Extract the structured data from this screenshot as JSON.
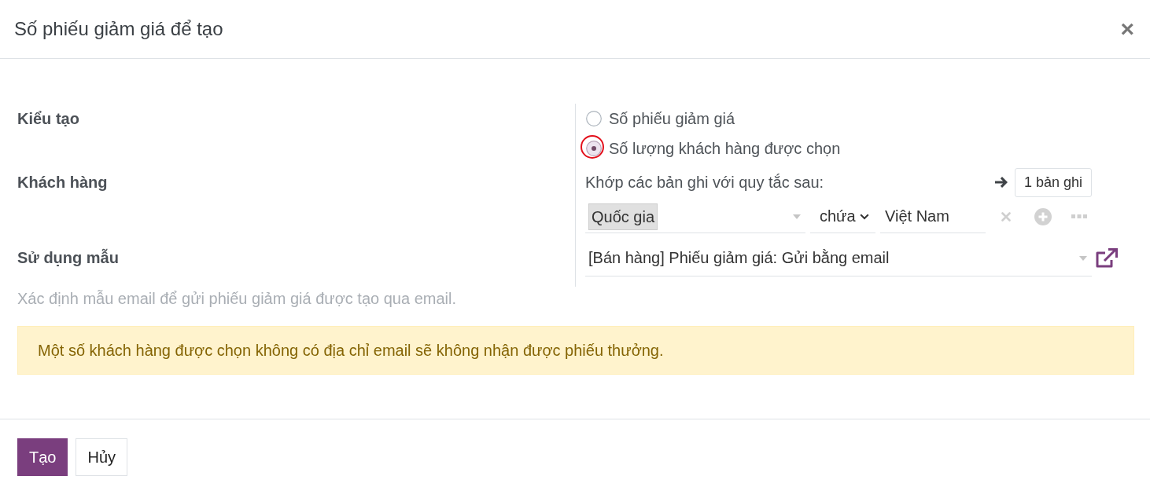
{
  "dialog": {
    "title": "Số phiếu giảm giá để tạo",
    "close": "×"
  },
  "fields": [
    {
      "kind": "radio",
      "label": "Kiểu tạo",
      "options": [
        {
          "label": "Số phiếu giảm giá",
          "selected": false,
          "highlighted": false
        },
        {
          "label": "Số lượng khách hàng được chọn",
          "selected": true,
          "highlighted": true
        }
      ]
    },
    {
      "kind": "domain",
      "label": "Khách hàng",
      "intro": "Khớp các bản ghi với quy tắc sau:",
      "record_count": "1 bản ghi",
      "rules": [
        {
          "field": "Quốc gia",
          "operator": "chứa",
          "value": "Việt Nam"
        }
      ]
    },
    {
      "kind": "select",
      "label": "Sử dụng mẫu",
      "value": "[Bán hàng] Phiếu giảm giá: Gửi bằng email",
      "help": "Xác định mẫu email để gửi phiếu giảm giá được tạo qua email."
    }
  ],
  "alert": {
    "text": "Một số khách hàng được chọn không có địa chỉ email sẽ không nhận được phiếu thưởng."
  },
  "buttons": [
    {
      "label": "Tạo",
      "kind": "primary"
    },
    {
      "label": "Hủy",
      "kind": "secondary"
    }
  ]
}
